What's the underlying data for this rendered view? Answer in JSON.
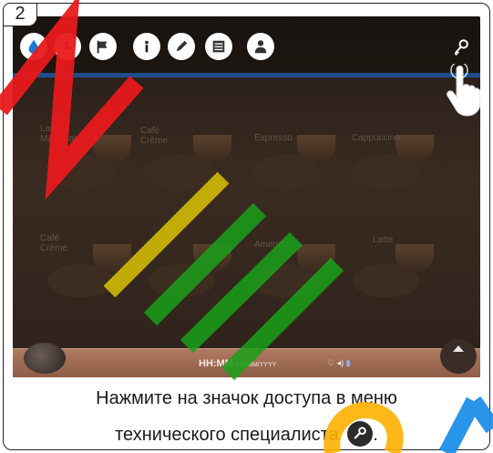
{
  "step": {
    "number": "2"
  },
  "toolbar": {
    "icons": [
      "water-drop-icon",
      "clock-icon",
      "flag-icon",
      "info-icon",
      "pencil-icon",
      "list-icon",
      "user-icon"
    ],
    "key_icon": "key-icon"
  },
  "drinks": {
    "row1": [
      "Latte Macchiato",
      "Café Crème",
      "Espresso",
      "Cappuccino"
    ],
    "row2": [
      "Café Crème",
      "",
      "Americano",
      "Latte"
    ]
  },
  "status_bar": {
    "time": "HH:MM",
    "date": "DD/MM/YYYY"
  },
  "caption": {
    "line1": "Нажмите на значок доступа в меню",
    "line2": "технического специалиста",
    "end": "."
  },
  "colors": {
    "accent_blue": "#1f4e8c",
    "watermark_red": "#e8191c",
    "watermark_yellow": "#f0d800",
    "watermark_green": "#1aa01a",
    "watermark_orange": "#ffb000",
    "watermark_blue": "#1e8fe8"
  }
}
